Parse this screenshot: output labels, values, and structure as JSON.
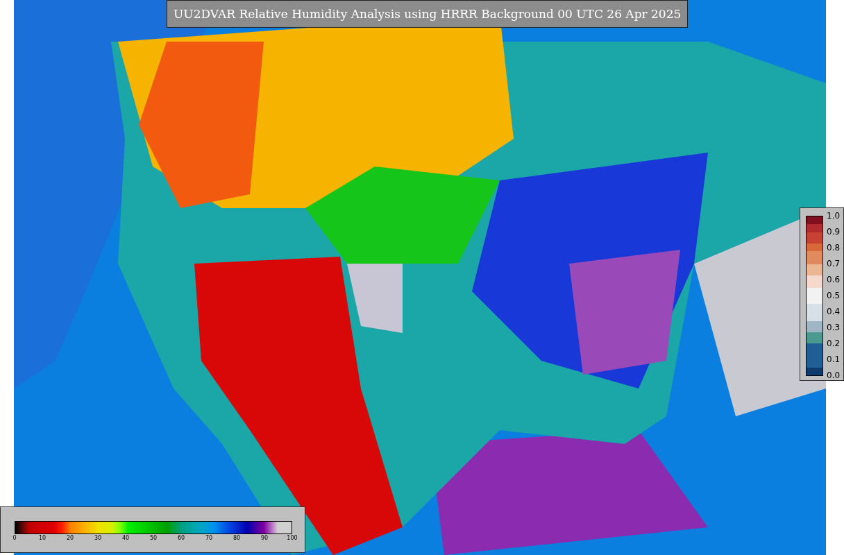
{
  "title": "UU2DVAR Relative Humidity Analysis using HRRR Background 00 UTC 26 Apr 2025",
  "humidity_colorbar": {
    "ticks": [
      "0",
      "10",
      "20",
      "30",
      "40",
      "50",
      "60",
      "70",
      "80",
      "90",
      "100"
    ]
  },
  "ratio_colorbar": {
    "ticks": [
      "1.0",
      "0.9",
      "0.8",
      "0.7",
      "0.6",
      "0.5",
      "0.4",
      "0.3",
      "0.2",
      "0.1",
      "0.0"
    ]
  }
}
